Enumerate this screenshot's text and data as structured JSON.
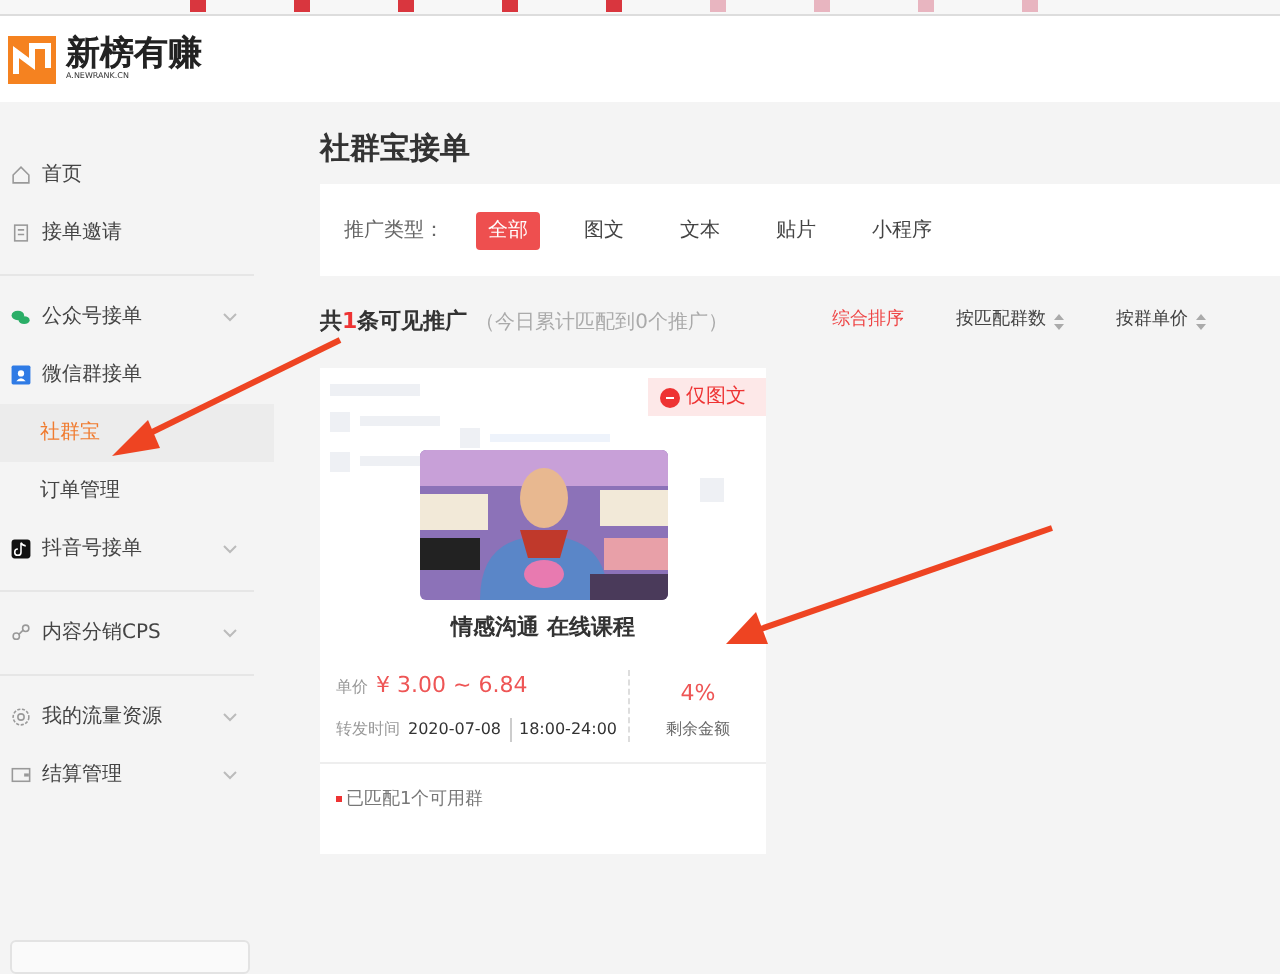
{
  "brand": {
    "name": "新榜有赚",
    "domain": "A.NEWRANK.CN"
  },
  "sidebar": {
    "groups": [
      {
        "items": [
          {
            "label": "首页",
            "kind": "item"
          },
          {
            "label": "接单邀请",
            "kind": "item"
          }
        ]
      },
      {
        "items": [
          {
            "label": "公众号接单",
            "kind": "item",
            "expandable": true
          },
          {
            "label": "微信群接单",
            "kind": "item"
          },
          {
            "label": "社群宝",
            "kind": "sub",
            "selected": true
          },
          {
            "label": "订单管理",
            "kind": "sub",
            "selected": false
          },
          {
            "label": "抖音号接单",
            "kind": "item",
            "expandable": true
          }
        ]
      },
      {
        "items": [
          {
            "label": "内容分销CPS",
            "kind": "item",
            "expandable": true
          }
        ]
      },
      {
        "items": [
          {
            "label": "我的流量资源",
            "kind": "item",
            "expandable": true
          },
          {
            "label": "结算管理",
            "kind": "item",
            "expandable": true
          }
        ]
      }
    ]
  },
  "page_title": "社群宝接单",
  "filter": {
    "label": "推广类型：",
    "options": [
      {
        "label": "全部",
        "selected": true
      },
      {
        "label": "图文",
        "selected": false
      },
      {
        "label": "文本",
        "selected": false
      },
      {
        "label": "贴片",
        "selected": false
      },
      {
        "label": "小程序",
        "selected": false
      }
    ]
  },
  "summary": {
    "prefix": "共",
    "count": "1",
    "suffix": "条可见推广",
    "note": "（今日累计匹配到0个推广）"
  },
  "sorts": [
    {
      "label": "综合排序",
      "selected": true,
      "sortable": false
    },
    {
      "label": "按匹配群数",
      "selected": false,
      "sortable": true
    },
    {
      "label": "按群单价",
      "selected": false,
      "sortable": true
    }
  ],
  "card": {
    "tag": "仅图文",
    "title": "情感沟通 在线课程",
    "price_label": "单价",
    "price": "¥ 3.00 ~ 6.84",
    "time_label": "转发时间",
    "date": "2020-07-08",
    "hours": "18:00-24:00",
    "percent": "4%",
    "percent_label": "剩余金额",
    "matched": "已匹配1个可用群"
  }
}
